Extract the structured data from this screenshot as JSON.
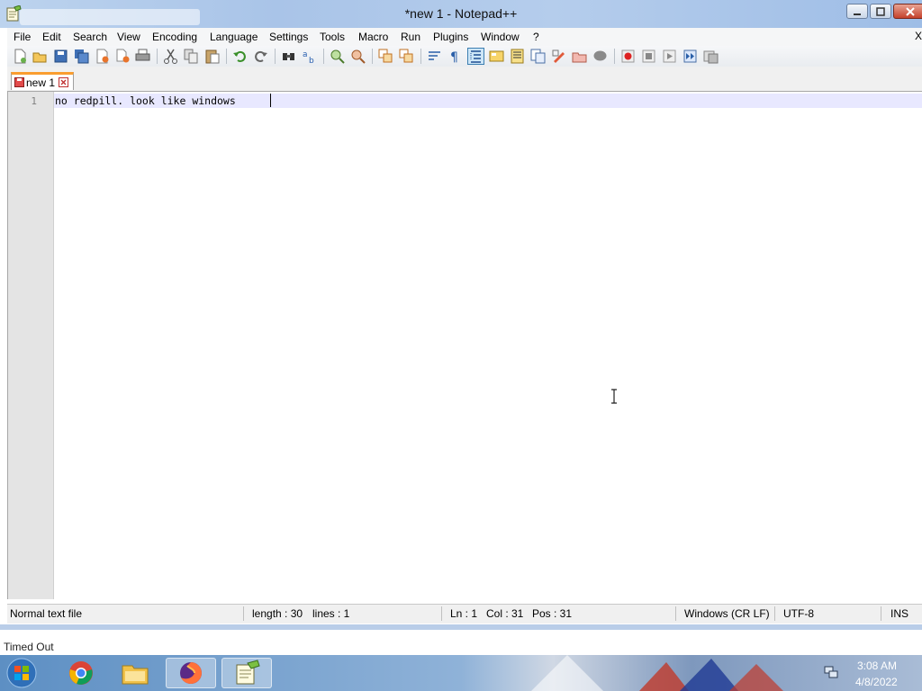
{
  "window": {
    "title": "*new 1 - Notepad++"
  },
  "menu": {
    "items": [
      "File",
      "Edit",
      "Search",
      "View",
      "Encoding",
      "Language",
      "Settings",
      "Tools",
      "Macro",
      "Run",
      "Plugins",
      "Window",
      "?"
    ],
    "close_glyph": "X"
  },
  "toolbar": {
    "buttons": [
      "new-file-icon",
      "open-file-icon",
      "save-icon",
      "save-all-icon",
      "close-icon",
      "close-all-icon",
      "print-icon",
      "cut-icon",
      "copy-icon",
      "paste-icon",
      "undo-icon",
      "redo-icon",
      "find-icon",
      "replace-icon",
      "zoom-in-icon",
      "zoom-out-icon",
      "sync-vertical-icon",
      "sync-horizontal-icon",
      "word-wrap-icon",
      "show-all-characters-icon",
      "indent-guide-icon",
      "user-defined-language-icon",
      "document-map-icon",
      "function-list-icon",
      "folder-as-workspace-icon",
      "monitoring-icon",
      "record-macro-icon",
      "stop-recording-icon",
      "playback-macro-icon",
      "run-macro-multiple-icon",
      "save-macro-icon"
    ]
  },
  "tabs": [
    {
      "label": "new 1",
      "active": true,
      "modified": true
    }
  ],
  "editor": {
    "lines": [
      {
        "number": "1",
        "text": "no redpill. look like windows"
      }
    ]
  },
  "status": {
    "file_type": "Normal text file",
    "length": "length : 30",
    "lines": "lines : 1",
    "ln": "Ln : 1",
    "col": "Col : 31",
    "pos": "Pos : 31",
    "eol": "Windows (CR LF)",
    "encoding": "UTF-8",
    "mode": "INS"
  },
  "strip": {
    "text": "Timed Out"
  },
  "taskbar": {
    "apps": [
      "chrome-icon",
      "file-explorer-icon",
      "firefox-icon",
      "notepad-plus-plus-icon"
    ],
    "time": "3:08 AM",
    "date": "4/8/2022"
  },
  "colors": {
    "tab_accent": "#fa9d2f",
    "current_line": "#e8e8ff",
    "gutter": "#e4e4e4"
  }
}
